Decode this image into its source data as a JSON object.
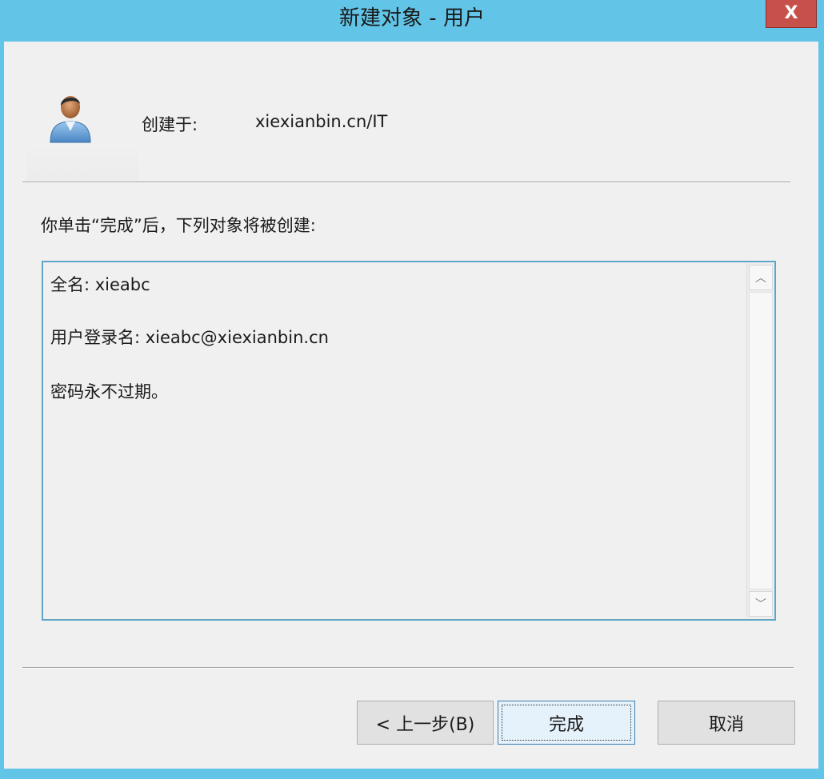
{
  "window": {
    "title": "新建对象 - 用户",
    "close_label": "X"
  },
  "header": {
    "created_in_label": "创建于:",
    "created_in_value": "xiexianbin.cn/IT",
    "icon": "user-icon"
  },
  "body": {
    "info_text": "你单击“完成”后，下列对象将被创建:",
    "summary_lines": [
      "全名: xieabc",
      "用户登录名: xieabc@xiexianbin.cn",
      "密码永不过期。"
    ]
  },
  "scrollbar": {
    "up_icon": "chevron-up-icon",
    "down_icon": "chevron-down-icon"
  },
  "buttons": {
    "back_label": "< 上一步(B)",
    "finish_label": "完成",
    "cancel_label": "取消"
  },
  "colors": {
    "titlebar": "#62c5e8",
    "close_button": "#c7504a",
    "dialog_bg": "#f0f0f0",
    "focus_border": "#3c7fb1"
  }
}
